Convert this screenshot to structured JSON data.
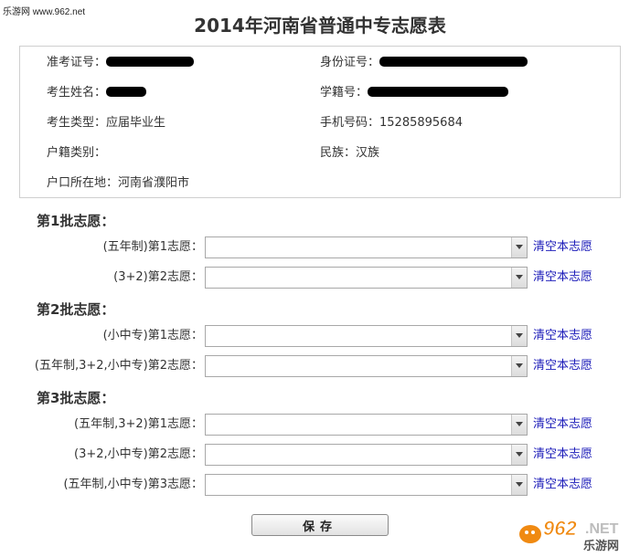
{
  "watermark_top": "乐游网 www.962.net",
  "title": "2014年河南省普通中专志愿表",
  "info": {
    "exam_no_label": "准考证号：",
    "id_label": "身份证号：",
    "name_label": "考生姓名：",
    "student_no_label": "学籍号：",
    "type_label": "考生类型：",
    "type_value": "应届毕业生",
    "phone_label": "手机号码：",
    "phone_value": "15285895684",
    "household_type_label": "户籍类别：",
    "household_type_value": "",
    "ethnicity_label": "民族：",
    "ethnicity_value": "汉族",
    "residence_label": "户口所在地：",
    "residence_value": "河南省濮阳市"
  },
  "batches": [
    {
      "title": "第1批志愿：",
      "choices": [
        {
          "label": "(五年制)第1志愿：",
          "value": "",
          "clear": "清空本志愿"
        },
        {
          "label": "(3+2)第2志愿：",
          "value": "",
          "clear": "清空本志愿"
        }
      ]
    },
    {
      "title": "第2批志愿：",
      "choices": [
        {
          "label": "(小中专)第1志愿：",
          "value": "",
          "clear": "清空本志愿"
        },
        {
          "label": "(五年制,3+2,小中专)第2志愿：",
          "value": "",
          "clear": "清空本志愿"
        }
      ]
    },
    {
      "title": "第3批志愿：",
      "choices": [
        {
          "label": "(五年制,3+2)第1志愿：",
          "value": "",
          "clear": "清空本志愿"
        },
        {
          "label": "(3+2,小中专)第2志愿：",
          "value": "",
          "clear": "清空本志愿"
        },
        {
          "label": "(五年制,小中专)第3志愿：",
          "value": "",
          "clear": "清空本志愿"
        }
      ]
    }
  ],
  "save_label": "保存",
  "logo": {
    "number": "962",
    "suffix": ".NET",
    "cn": "乐游网"
  },
  "colors": {
    "link": "#1a1ab8",
    "text": "#333333",
    "logo_orange": "#f08a12"
  }
}
